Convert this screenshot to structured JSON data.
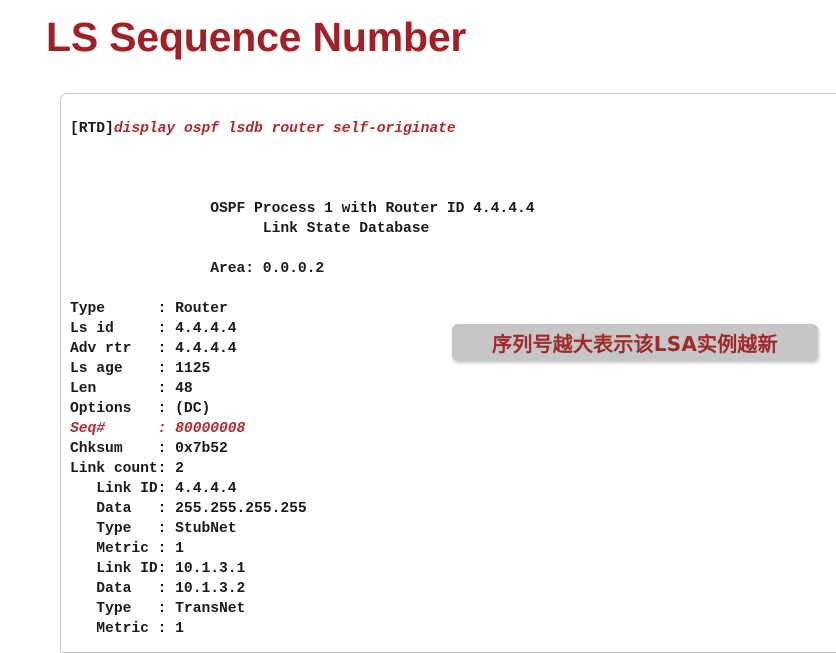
{
  "slide": {
    "title": "LS Sequence Number",
    "title_color": "#a02128",
    "background_color": "#ffffff"
  },
  "terminal": {
    "prompt": "[RTD]",
    "command": "display ospf lsdb router self-originate",
    "command_color": "#b02b2f",
    "border_color": "#c9c9c9",
    "lines": [
      {
        "id": "blank-1",
        "text": ""
      },
      {
        "id": "process-header",
        "text": "                OSPF Process 1 with Router ID 4.4.4.4"
      },
      {
        "id": "lsdb-header",
        "text": "                      Link State Database"
      },
      {
        "id": "blank-2",
        "text": ""
      },
      {
        "id": "area",
        "text": "                Area: 0.0.0.2"
      },
      {
        "id": "blank-3",
        "text": ""
      },
      {
        "id": "type",
        "text": "Type      : Router"
      },
      {
        "id": "ls-id",
        "text": "Ls id     : 4.4.4.4"
      },
      {
        "id": "adv-rtr",
        "text": "Adv rtr   : 4.4.4.4"
      },
      {
        "id": "ls-age",
        "text": "Ls age    : 1125"
      },
      {
        "id": "len",
        "text": "Len       : 48"
      },
      {
        "id": "options",
        "text": "Options   : (DC)"
      },
      {
        "id": "seq-number",
        "text": "Seq#      : 80000008",
        "highlight": true
      },
      {
        "id": "chksum",
        "text": "Chksum    : 0x7b52"
      },
      {
        "id": "link-count",
        "text": "Link count: 2"
      },
      {
        "id": "link-id-1",
        "text": "   Link ID: 4.4.4.4"
      },
      {
        "id": "data-1",
        "text": "   Data   : 255.255.255.255"
      },
      {
        "id": "type-1",
        "text": "   Type   : StubNet"
      },
      {
        "id": "metric-1",
        "text": "   Metric : 1"
      },
      {
        "id": "link-id-2",
        "text": "   Link ID: 10.1.3.1"
      },
      {
        "id": "data-2",
        "text": "   Data   : 10.1.3.2"
      },
      {
        "id": "type-2",
        "text": "   Type   : TransNet"
      },
      {
        "id": "metric-2",
        "text": "   Metric : 1"
      }
    ]
  },
  "annotation": {
    "text": "序列号越大表示该LSA实例越新",
    "text_color": "#9e2a2b",
    "background_color": "#c6c6c6"
  }
}
